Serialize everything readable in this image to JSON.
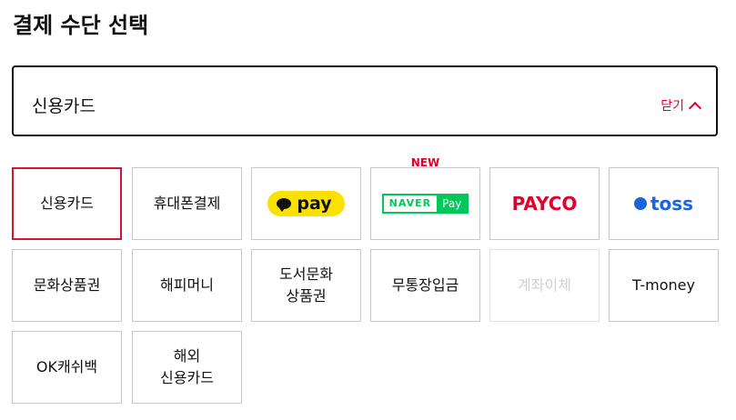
{
  "header": {
    "title": "결제 수단 선택"
  },
  "selector": {
    "selected_label": "신용카드",
    "toggle_label": "닫기"
  },
  "methods": [
    {
      "label": "신용카드"
    },
    {
      "label": "휴대폰결제"
    },
    {
      "label": "pay",
      "logo": "kakaopay-logo"
    },
    {
      "naver": "NAVER",
      "pay": "Pay",
      "badge": "NEW",
      "logo": "naverpay-logo"
    },
    {
      "label": "PAYCO",
      "logo": "payco-logo"
    },
    {
      "label": "toss",
      "logo": "toss-logo"
    },
    {
      "label": "문화상품권"
    },
    {
      "label": "해피머니"
    },
    {
      "line1": "도서문화",
      "line2": "상품권"
    },
    {
      "label": "무통장입금"
    },
    {
      "label": "계좌이체"
    },
    {
      "label": "T-money"
    },
    {
      "label": "OK캐쉬백"
    },
    {
      "line1": "해외",
      "line2": "신용카드"
    }
  ],
  "colors": {
    "accent": "#e0002a",
    "selected_border": "#cf1733",
    "kakao_yellow": "#fae100",
    "naver_green": "#03c75a",
    "toss_blue": "#1b64da"
  }
}
